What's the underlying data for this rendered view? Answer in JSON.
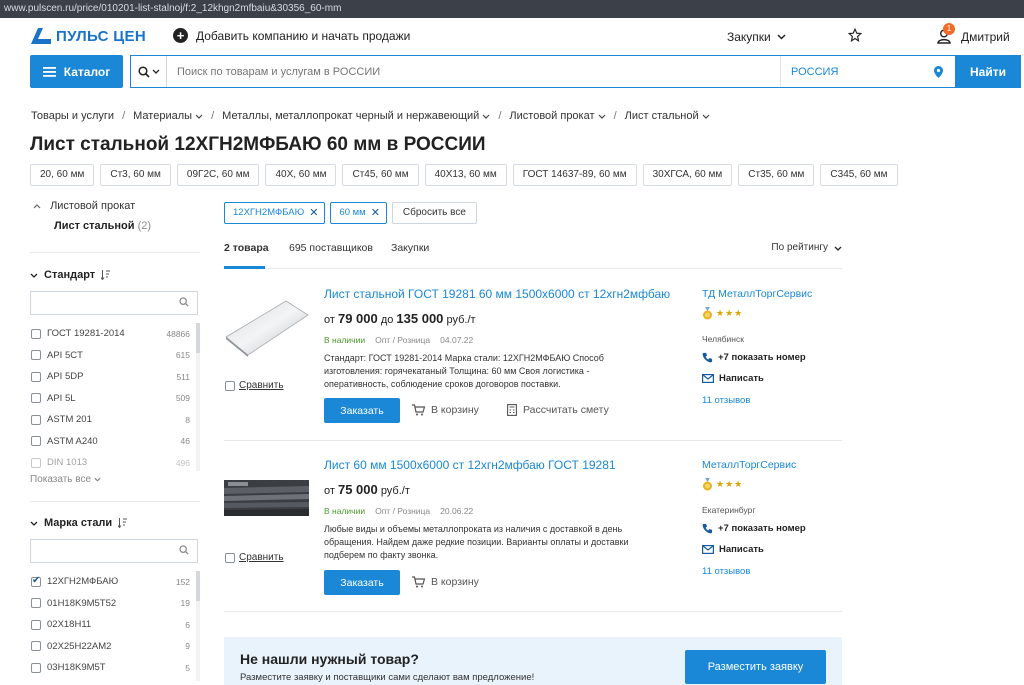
{
  "browser": {
    "url": "www.pulscen.ru/price/010201-list-stalnoj/f:2_12khgn2mfbaiu&30356_60-mm"
  },
  "header": {
    "logo_text": "ПУЛЬС ЦЕН",
    "add_company": "Добавить компанию и начать продажи",
    "purchases": "Закупки",
    "user_name": "Дмитрий",
    "notification_count": "1"
  },
  "search": {
    "catalog_label": "Каталог",
    "placeholder": "Поиск по товарам и услугам в РОССИИ",
    "region": "РОССИЯ",
    "button": "Найти"
  },
  "breadcrumb": [
    "Товары и услуги",
    "Материалы",
    "Металлы, металлопрокат черный и нержавеющий",
    "Листовой прокат",
    "Лист стальной"
  ],
  "page_title": "Лист стальной 12ХГН2МФБАЮ 60 мм в РОССИИ",
  "chips": [
    "20, 60 мм",
    "Ст3, 60 мм",
    "09Г2С, 60 мм",
    "40Х, 60 мм",
    "Ст45, 60 мм",
    "40Х13, 60 мм",
    "ГОСТ 14637-89, 60 мм",
    "30ХГСА, 60 мм",
    "Ст35, 60 мм",
    "С345, 60 мм"
  ],
  "sidebar": {
    "category": "Листовой прокат",
    "subcategory": "Лист стальной",
    "subcategory_count": "(2)",
    "standard": {
      "title": "Стандарт",
      "items": [
        {
          "label": "ГОСТ 19281-2014",
          "count": "48866"
        },
        {
          "label": "API 5CT",
          "count": "615"
        },
        {
          "label": "API 5DP",
          "count": "511"
        },
        {
          "label": "API 5L",
          "count": "509"
        },
        {
          "label": "ASTM 201",
          "count": "8"
        },
        {
          "label": "ASTM A240",
          "count": "46"
        },
        {
          "label": "DIN 1013",
          "count": "496"
        }
      ],
      "show_all": "Показать все"
    },
    "grade": {
      "title": "Марка стали",
      "items": [
        {
          "label": "12ХГН2МФБАЮ",
          "count": "152",
          "checked": true
        },
        {
          "label": "01H18K9M5T52",
          "count": "19"
        },
        {
          "label": "02X18H11",
          "count": "6"
        },
        {
          "label": "02X25H22AM2",
          "count": "9"
        },
        {
          "label": "03H18K9M5T",
          "count": "5"
        }
      ]
    }
  },
  "filters": {
    "tags": [
      "12ХГН2МФБАЮ",
      "60 мм"
    ],
    "reset": "Сбросить все"
  },
  "tabs": {
    "items": [
      "2 товара",
      "695 поставщиков",
      "Закупки"
    ],
    "sort": "По рейтингу"
  },
  "products": [
    {
      "title": "Лист стальной ГОСТ 19281 60 мм 1500х6000 ст 12хгн2мфбаю",
      "price_from_prefix": "от",
      "price_from": "79 000",
      "price_to_prefix": "до",
      "price_to": "135 000",
      "price_unit": "руб./т",
      "availability": "В наличии",
      "sale_type": "Опт / Розница",
      "date": "04.07.22",
      "description": "Стандарт: ГОСТ 19281-2014 Марка стали: 12ХГН2МФБАЮ Способ изготовления: горячекатаный Толщина: 60 мм Своя логистика - оперативность, соблюдение сроков договоров поставки.",
      "order": "Заказать",
      "cart": "В корзину",
      "estimate": "Рассчитать смету",
      "compare": "Сравнить",
      "seller": "ТД МеталлТоргСервис",
      "city": "Челябинск",
      "phone": "+7 показать номер",
      "write": "Написать",
      "reviews": "11 отзывов",
      "stars": "★★★"
    },
    {
      "title": "Лист 60 мм 1500х6000 ст 12хгн2мфбаю ГОСТ 19281",
      "price_from_prefix": "от",
      "price_from": "75 000",
      "price_unit": "руб./т",
      "availability": "В наличии",
      "sale_type": "Опт / Розница",
      "date": "20.06.22",
      "description": "Любые виды и объемы металлопроката из наличия с доставкой в день обращения. Найдем даже редкие позиции. Варианты оплаты и доставки подберем по факту звонка.",
      "order": "Заказать",
      "cart": "В корзину",
      "compare": "Сравнить",
      "seller": "МеталлТоргСервис",
      "city": "Екатеринбург",
      "phone": "+7 показать номер",
      "write": "Написать",
      "reviews": "11 отзывов",
      "stars": "★★★"
    }
  ],
  "not_found": {
    "title": "Не нашли нужный товар?",
    "text": "Разместите заявку и поставщики сами сделают вам предложение!",
    "button": "Разместить заявку"
  },
  "colors": {
    "accent": "#1a88d6",
    "in_stock": "#4a9a2c",
    "badge": "#f06a2a",
    "star": "#d8a400"
  }
}
